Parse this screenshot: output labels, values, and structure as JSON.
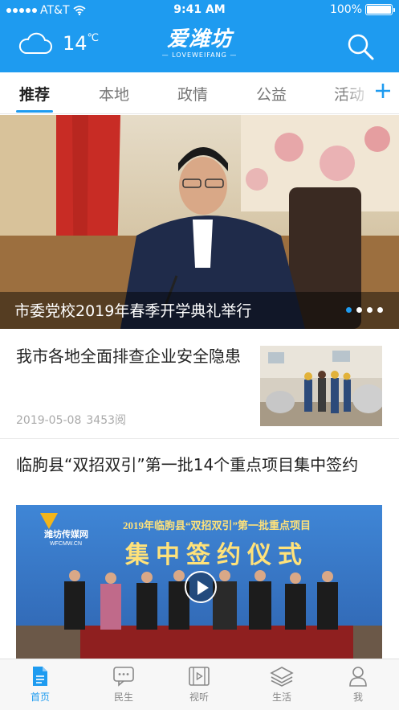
{
  "status_bar": {
    "carrier": "AT&T",
    "time": "9:41 AM",
    "battery": "100%"
  },
  "header": {
    "weather_icon": "cloud-icon",
    "temperature": "14",
    "temperature_unit": "℃",
    "logo_text": "爱潍坊",
    "logo_subtext": "— LOVEWEIFANG —",
    "search_icon": "search-icon"
  },
  "colors": {
    "brand": "#1e9bf0",
    "tab_inactive": "#777777",
    "meta_text": "#aaaaaa"
  },
  "tabs": [
    {
      "label": "推荐",
      "active": true
    },
    {
      "label": "本地",
      "active": false
    },
    {
      "label": "政情",
      "active": false
    },
    {
      "label": "公益",
      "active": false
    },
    {
      "label": "活动",
      "active": false
    }
  ],
  "tab_add_icon": "plus-icon",
  "banner": {
    "title": "市委党校2019年春季开学典礼举行",
    "slide_count": 4,
    "active_slide": 1
  },
  "news": [
    {
      "title": "我市各地全面排查企业安全隐患",
      "date": "2019-05-08",
      "views": "3453阅"
    },
    {
      "title": "临朐县“双招双引”第一批14个重点项目集中签约",
      "video": {
        "banner_line": "2019年临朐县“双招双引”第一批重点项目",
        "headline": "集中签约仪式",
        "watermark": "潍坊传媒网",
        "watermark_sub": "WFCMW.CN"
      }
    }
  ],
  "bottom_nav": [
    {
      "label": "首页",
      "icon": "document-icon",
      "active": true
    },
    {
      "label": "民生",
      "icon": "chat-icon",
      "active": false
    },
    {
      "label": "视听",
      "icon": "film-icon",
      "active": false
    },
    {
      "label": "生活",
      "icon": "layers-icon",
      "active": false
    },
    {
      "label": "我",
      "icon": "user-icon",
      "active": false
    }
  ]
}
